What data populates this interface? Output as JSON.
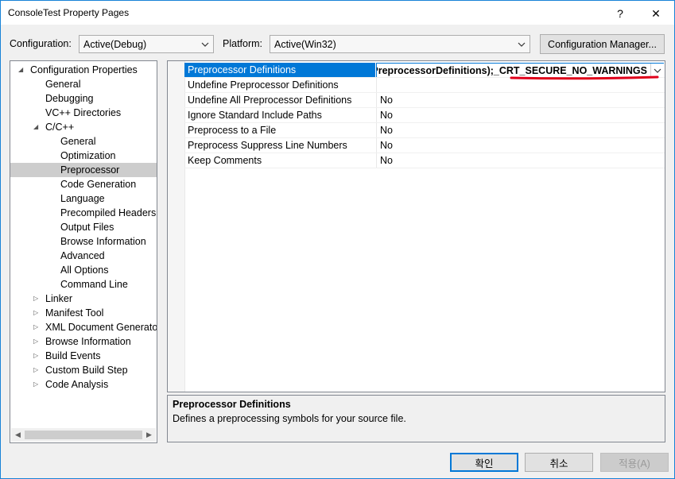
{
  "window": {
    "title": "ConsoleTest Property Pages",
    "help_glyph": "?",
    "close_glyph": "✕"
  },
  "config_row": {
    "configuration_label": "Configuration:",
    "configuration_value": "Active(Debug)",
    "platform_label": "Platform:",
    "platform_value": "Active(Win32)",
    "config_manager_label": "Configuration Manager..."
  },
  "tree": [
    {
      "label": "Configuration Properties",
      "level": 0,
      "expander": "expanded"
    },
    {
      "label": "General",
      "level": 1,
      "expander": "none"
    },
    {
      "label": "Debugging",
      "level": 1,
      "expander": "none"
    },
    {
      "label": "VC++ Directories",
      "level": 1,
      "expander": "none"
    },
    {
      "label": "C/C++",
      "level": 1,
      "expander": "expanded"
    },
    {
      "label": "General",
      "level": 2,
      "expander": "none"
    },
    {
      "label": "Optimization",
      "level": 2,
      "expander": "none"
    },
    {
      "label": "Preprocessor",
      "level": 2,
      "expander": "none",
      "selected": true
    },
    {
      "label": "Code Generation",
      "level": 2,
      "expander": "none"
    },
    {
      "label": "Language",
      "level": 2,
      "expander": "none"
    },
    {
      "label": "Precompiled Headers",
      "level": 2,
      "expander": "none"
    },
    {
      "label": "Output Files",
      "level": 2,
      "expander": "none"
    },
    {
      "label": "Browse Information",
      "level": 2,
      "expander": "none"
    },
    {
      "label": "Advanced",
      "level": 2,
      "expander": "none"
    },
    {
      "label": "All Options",
      "level": 2,
      "expander": "none"
    },
    {
      "label": "Command Line",
      "level": 2,
      "expander": "none"
    },
    {
      "label": "Linker",
      "level": 1,
      "expander": "collapsed"
    },
    {
      "label": "Manifest Tool",
      "level": 1,
      "expander": "collapsed"
    },
    {
      "label": "XML Document Generator",
      "level": 1,
      "expander": "collapsed"
    },
    {
      "label": "Browse Information",
      "level": 1,
      "expander": "collapsed"
    },
    {
      "label": "Build Events",
      "level": 1,
      "expander": "collapsed"
    },
    {
      "label": "Custom Build Step",
      "level": 1,
      "expander": "collapsed"
    },
    {
      "label": "Code Analysis",
      "level": 1,
      "expander": "collapsed"
    }
  ],
  "properties": [
    {
      "name": "Preprocessor Definitions",
      "value": "E;%(PreprocessorDefinitions);_CRT_SECURE_NO_WARNINGS",
      "selected": true
    },
    {
      "name": "Undefine Preprocessor Definitions",
      "value": ""
    },
    {
      "name": "Undefine All Preprocessor Definitions",
      "value": "No"
    },
    {
      "name": "Ignore Standard Include Paths",
      "value": "No"
    },
    {
      "name": "Preprocess to a File",
      "value": "No"
    },
    {
      "name": "Preprocess Suppress Line Numbers",
      "value": "No"
    },
    {
      "name": "Keep Comments",
      "value": "No"
    }
  ],
  "description": {
    "title": "Preprocessor Definitions",
    "text": "Defines a preprocessing symbols for your source file."
  },
  "buttons": {
    "ok": "확인",
    "cancel": "취소",
    "apply": "적용(A)"
  },
  "colors": {
    "selection_blue": "#0078d7",
    "annotation_red": "#e0001a",
    "tree_selected": "#cdcdcd"
  }
}
